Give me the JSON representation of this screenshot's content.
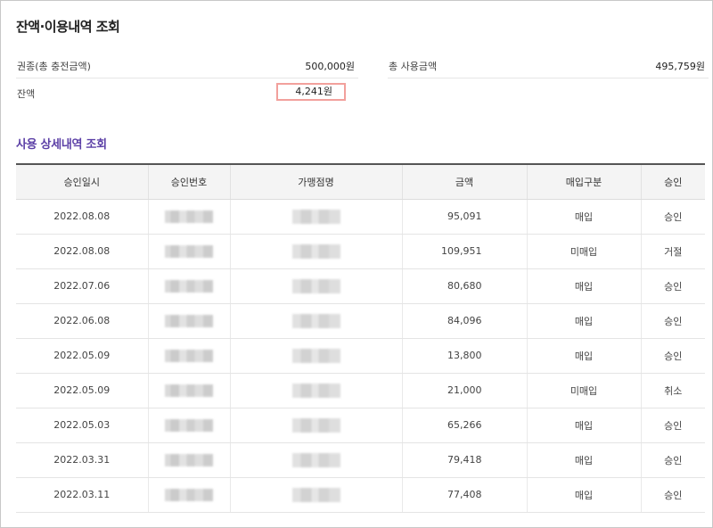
{
  "page_title": "잔액·이용내역 조회",
  "summary": {
    "voucher_label": "권종(총 충전금액)",
    "voucher_value": "500,000원",
    "total_used_label": "총 사용금액",
    "total_used_value": "495,759원",
    "balance_label": "잔액",
    "balance_value": "4,241원",
    "balance_highlight_color": "#f2a09c"
  },
  "section_title": "사용 상세내역 조회",
  "section_title_color": "#5b3fa6",
  "table": {
    "headers": [
      "승인일시",
      "승인번호",
      "가맹점명",
      "금액",
      "매입구분",
      "승인"
    ],
    "rows": [
      {
        "date": "2022.08.08",
        "amount": "95,091",
        "purchase": "매입",
        "status": "승인"
      },
      {
        "date": "2022.08.08",
        "amount": "109,951",
        "purchase": "미매입",
        "status": "거절"
      },
      {
        "date": "2022.07.06",
        "amount": "80,680",
        "purchase": "매입",
        "status": "승인"
      },
      {
        "date": "2022.06.08",
        "amount": "84,096",
        "purchase": "매입",
        "status": "승인"
      },
      {
        "date": "2022.05.09",
        "amount": "13,800",
        "purchase": "매입",
        "status": "승인"
      },
      {
        "date": "2022.05.09",
        "amount": "21,000",
        "purchase": "미매입",
        "status": "취소"
      },
      {
        "date": "2022.05.03",
        "amount": "65,266",
        "purchase": "매입",
        "status": "승인"
      },
      {
        "date": "2022.03.31",
        "amount": "79,418",
        "purchase": "매입",
        "status": "승인"
      },
      {
        "date": "2022.03.11",
        "amount": "77,408",
        "purchase": "매입",
        "status": "승인"
      }
    ]
  }
}
